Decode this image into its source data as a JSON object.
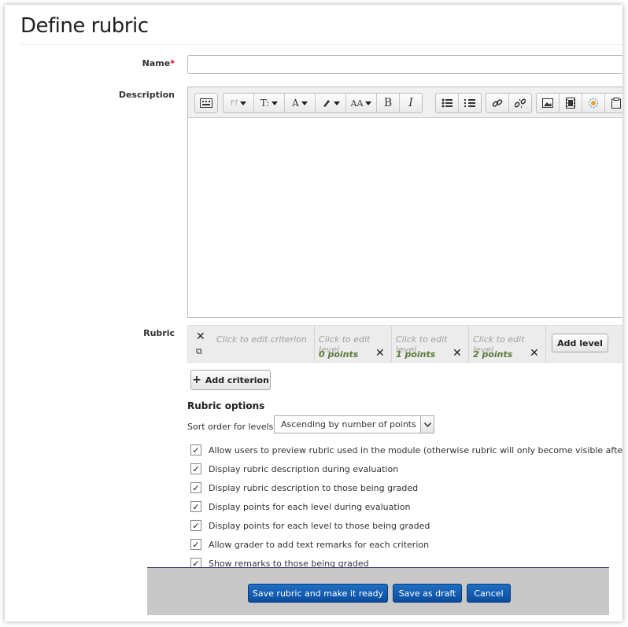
{
  "page": {
    "title": "Define rubric"
  },
  "form": {
    "name_label": "Name",
    "required_mark": "*",
    "name_value": "",
    "description_label": "Description",
    "rubric_label": "Rubric"
  },
  "editor": {
    "toolbar_icons": [
      "keyboard-icon",
      "font-family-icon",
      "font-size-icon",
      "font-color-icon",
      "highlight-icon",
      "text-case-icon",
      "bold-icon",
      "italic-icon",
      "unordered-list-icon",
      "ordered-list-icon",
      "link-icon",
      "unlink-icon",
      "image-icon",
      "media-icon",
      "special-char-icon",
      "paste-icon"
    ],
    "font_family_label": "Ff",
    "font_size_label": "T:",
    "bold_label": "B",
    "italic_label": "I"
  },
  "rubric": {
    "criterion_placeholder": "Click to edit criterion",
    "levels": [
      {
        "placeholder": "Click to edit level",
        "points": "0 points"
      },
      {
        "placeholder": "Click to edit level",
        "points": "1 points"
      },
      {
        "placeholder": "Click to edit level",
        "points": "2 points"
      }
    ],
    "add_level_label": "Add level",
    "add_criterion_label": "Add criterion"
  },
  "options": {
    "title": "Rubric options",
    "sort_label": "Sort order for levels:",
    "sort_value": "Ascending by number of points",
    "checkboxes": [
      {
        "label": "Allow users to preview rubric used in the module (otherwise rubric will only become visible after grad",
        "checked": true
      },
      {
        "label": "Display rubric description during evaluation",
        "checked": true
      },
      {
        "label": "Display rubric description to those being graded",
        "checked": true
      },
      {
        "label": "Display points for each level during evaluation",
        "checked": true
      },
      {
        "label": "Display points for each level to those being graded",
        "checked": true
      },
      {
        "label": "Allow grader to add text remarks for each criterion",
        "checked": true
      },
      {
        "label": "Show remarks to those being graded",
        "checked": true
      }
    ]
  },
  "footer": {
    "save_ready_label": "Save rubric and make it ready",
    "save_draft_label": "Save as draft",
    "cancel_label": "Cancel"
  },
  "colors": {
    "primary_button": "#0a4d9e",
    "required": "#d0021b",
    "points_text": "#5a7a3a"
  }
}
